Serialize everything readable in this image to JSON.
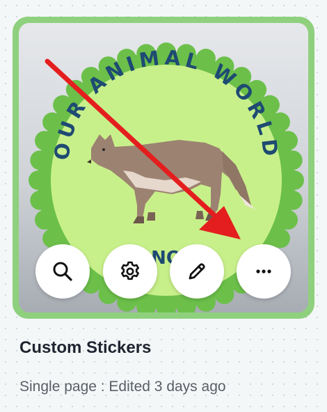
{
  "card": {
    "title": "Custom Stickers",
    "subtitle": "Single page : Edited 3 days ago",
    "thumbnail": {
      "badge_text_top": "OUR ANIMAL WORLD",
      "badge_text_bottom_visible": "NO",
      "badge_colors": {
        "outer": "#6cc04a",
        "inner": "#c8f08a",
        "text": "#1e4a73"
      }
    },
    "actions": [
      {
        "name": "search",
        "icon": "search-icon"
      },
      {
        "name": "settings",
        "icon": "gear-icon"
      },
      {
        "name": "edit",
        "icon": "pencil-icon"
      },
      {
        "name": "more",
        "icon": "more-horizontal-icon"
      }
    ],
    "border_color": "#8fd07e"
  },
  "annotation": {
    "arrow_color": "#e41e1e",
    "points_to": "more"
  }
}
